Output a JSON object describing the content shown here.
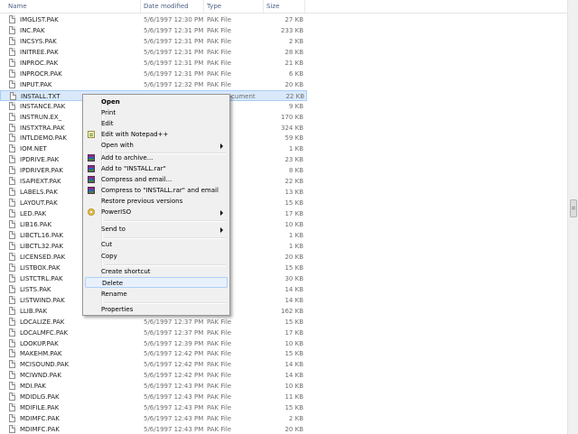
{
  "columns": {
    "name": "Name",
    "date": "Date modified",
    "type": "Type",
    "size": "Size"
  },
  "files": [
    {
      "name": "IMGLIST.PAK",
      "date": "5/6/1997 12:30 PM",
      "type": "PAK File",
      "size": "27 KB"
    },
    {
      "name": "INC.PAK",
      "date": "5/6/1997 12:31 PM",
      "type": "PAK File",
      "size": "233 KB"
    },
    {
      "name": "INCSYS.PAK",
      "date": "5/6/1997 12:31 PM",
      "type": "PAK File",
      "size": "2 KB"
    },
    {
      "name": "INITREE.PAK",
      "date": "5/6/1997 12:31 PM",
      "type": "PAK File",
      "size": "28 KB"
    },
    {
      "name": "INPROC.PAK",
      "date": "5/6/1997 12:31 PM",
      "type": "PAK File",
      "size": "21 KB"
    },
    {
      "name": "INPROCR.PAK",
      "date": "5/6/1997 12:31 PM",
      "type": "PAK File",
      "size": "6 KB"
    },
    {
      "name": "INPUT.PAK",
      "date": "5/6/1997 12:32 PM",
      "type": "PAK File",
      "size": "20 KB"
    },
    {
      "name": "INSTALL.TXT",
      "date": "5/6/1997 12:32 PM",
      "type": "Text Document",
      "size": "22 KB"
    },
    {
      "name": "INSTANCE.PAK",
      "date": "",
      "type": "",
      "size": "9 KB"
    },
    {
      "name": "INSTRUN.EX_",
      "date": "",
      "type": "",
      "size": "170 KB"
    },
    {
      "name": "INSTXTRA.PAK",
      "date": "",
      "type": "",
      "size": "324 KB"
    },
    {
      "name": "INTLDEMO.PAK",
      "date": "",
      "type": "",
      "size": "59 KB"
    },
    {
      "name": "IOM.NET",
      "date": "",
      "type": "",
      "size": "1 KB"
    },
    {
      "name": "IPDRIVE.PAK",
      "date": "",
      "type": "",
      "size": "23 KB"
    },
    {
      "name": "IPDRIVER.PAK",
      "date": "",
      "type": "",
      "size": "8 KB"
    },
    {
      "name": "ISAPIEXT.PAK",
      "date": "",
      "type": "",
      "size": "22 KB"
    },
    {
      "name": "LABELS.PAK",
      "date": "",
      "type": "",
      "size": "13 KB"
    },
    {
      "name": "LAYOUT.PAK",
      "date": "",
      "type": "",
      "size": "15 KB"
    },
    {
      "name": "LED.PAK",
      "date": "",
      "type": "",
      "size": "17 KB"
    },
    {
      "name": "LIB16.PAK",
      "date": "",
      "type": "",
      "size": "10 KB"
    },
    {
      "name": "LIBCTL16.PAK",
      "date": "",
      "type": "",
      "size": "1 KB"
    },
    {
      "name": "LIBCTL32.PAK",
      "date": "",
      "type": "",
      "size": "1 KB"
    },
    {
      "name": "LICENSED.PAK",
      "date": "",
      "type": "",
      "size": "20 KB"
    },
    {
      "name": "LISTBOX.PAK",
      "date": "",
      "type": "",
      "size": "15 KB"
    },
    {
      "name": "LISTCTRL.PAK",
      "date": "",
      "type": "",
      "size": "30 KB"
    },
    {
      "name": "LISTS.PAK",
      "date": "",
      "type": "",
      "size": "14 KB"
    },
    {
      "name": "LISTWIND.PAK",
      "date": "",
      "type": "",
      "size": "14 KB"
    },
    {
      "name": "LLIB.PAK",
      "date": "",
      "type": "",
      "size": "162 KB"
    },
    {
      "name": "LOCALIZE.PAK",
      "date": "5/6/1997 12:37 PM",
      "type": "PAK File",
      "size": "15 KB"
    },
    {
      "name": "LOCALMFC.PAK",
      "date": "5/6/1997 12:37 PM",
      "type": "PAK File",
      "size": "17 KB"
    },
    {
      "name": "LOOKUP.PAK",
      "date": "5/6/1997 12:39 PM",
      "type": "PAK File",
      "size": "10 KB"
    },
    {
      "name": "MAKEHM.PAK",
      "date": "5/6/1997 12:42 PM",
      "type": "PAK File",
      "size": "15 KB"
    },
    {
      "name": "MCISOUND.PAK",
      "date": "5/6/1997 12:42 PM",
      "type": "PAK File",
      "size": "14 KB"
    },
    {
      "name": "MCIWND.PAK",
      "date": "5/6/1997 12:42 PM",
      "type": "PAK File",
      "size": "14 KB"
    },
    {
      "name": "MDI.PAK",
      "date": "5/6/1997 12:43 PM",
      "type": "PAK File",
      "size": "10 KB"
    },
    {
      "name": "MDIDLG.PAK",
      "date": "5/6/1997 12:43 PM",
      "type": "PAK File",
      "size": "11 KB"
    },
    {
      "name": "MDIFILE.PAK",
      "date": "5/6/1997 12:43 PM",
      "type": "PAK File",
      "size": "15 KB"
    },
    {
      "name": "MDIMFC.PAK",
      "date": "5/6/1997 12:43 PM",
      "type": "PAK File",
      "size": "2 KB"
    },
    {
      "name": "MDIMFC.PAK",
      "date": "5/6/1997 12:43 PM",
      "type": "PAK File",
      "size": "20 KB"
    }
  ],
  "context_menu": {
    "open": "Open",
    "print": "Print",
    "edit": "Edit",
    "edit_notepad": "Edit with Notepad++",
    "open_with": "Open with",
    "add_archive": "Add to archive...",
    "add_rar": "Add to \"INSTALL.rar\"",
    "compress_email": "Compress and email...",
    "compress_rar_email": "Compress to \"INSTALL.rar\" and email",
    "restore": "Restore previous versions",
    "poweriso": "PowerISO",
    "send_to": "Send to",
    "cut": "Cut",
    "copy": "Copy",
    "create_shortcut": "Create shortcut",
    "delete": "Delete",
    "rename": "Rename",
    "properties": "Properties"
  },
  "icons": {
    "file": "file-icon",
    "notepad": "notepad-plus-plus-icon",
    "winrar": "winrar-icon",
    "poweriso": "poweriso-icon",
    "submenu": "submenu-arrow-icon"
  },
  "colors": {
    "selection": "#d9e9fb",
    "menu_bg": "#f0f0f0",
    "hover": "#e8f1fb",
    "header_text": "#4d6185"
  }
}
